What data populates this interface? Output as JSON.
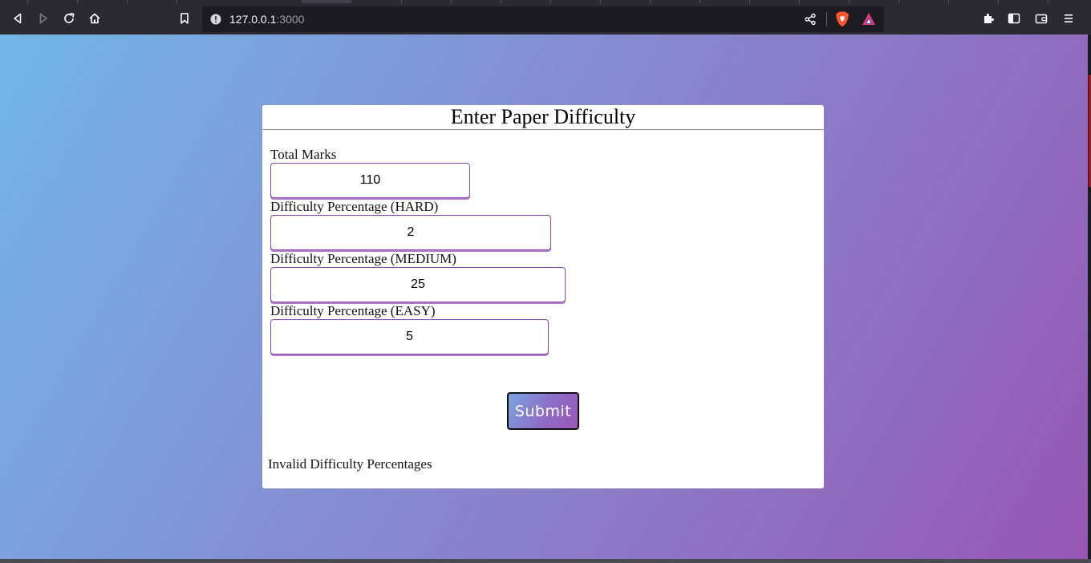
{
  "browser": {
    "url_host": "127.0.0.1",
    "url_port": ":3000",
    "icons": [
      "back-icon",
      "forward-icon",
      "reload-icon",
      "home-icon",
      "bookmark-icon",
      "site-info-icon",
      "share-icon",
      "brave-shields-icon",
      "brave-rewards-icon",
      "extensions-icon",
      "sidebar-icon",
      "wallet-icon",
      "menu-icon"
    ]
  },
  "page": {
    "title": "Enter Paper Difficulty",
    "fields": {
      "total_marks": {
        "label": "Total Marks",
        "value": "110"
      },
      "hard": {
        "label": "Difficulty Percentage (HARD)",
        "value": "2"
      },
      "medium": {
        "label": "Difficulty Percentage (MEDIUM)",
        "value": "25"
      },
      "easy": {
        "label": "Difficulty Percentage (EASY)",
        "value": "5"
      }
    },
    "submit_label": "Submit",
    "error_message": "Invalid Difficulty Percentages"
  },
  "colors": {
    "gradient_start": "#72b6e6",
    "gradient_end": "#9657b3",
    "input_border": "#8e44ad"
  }
}
